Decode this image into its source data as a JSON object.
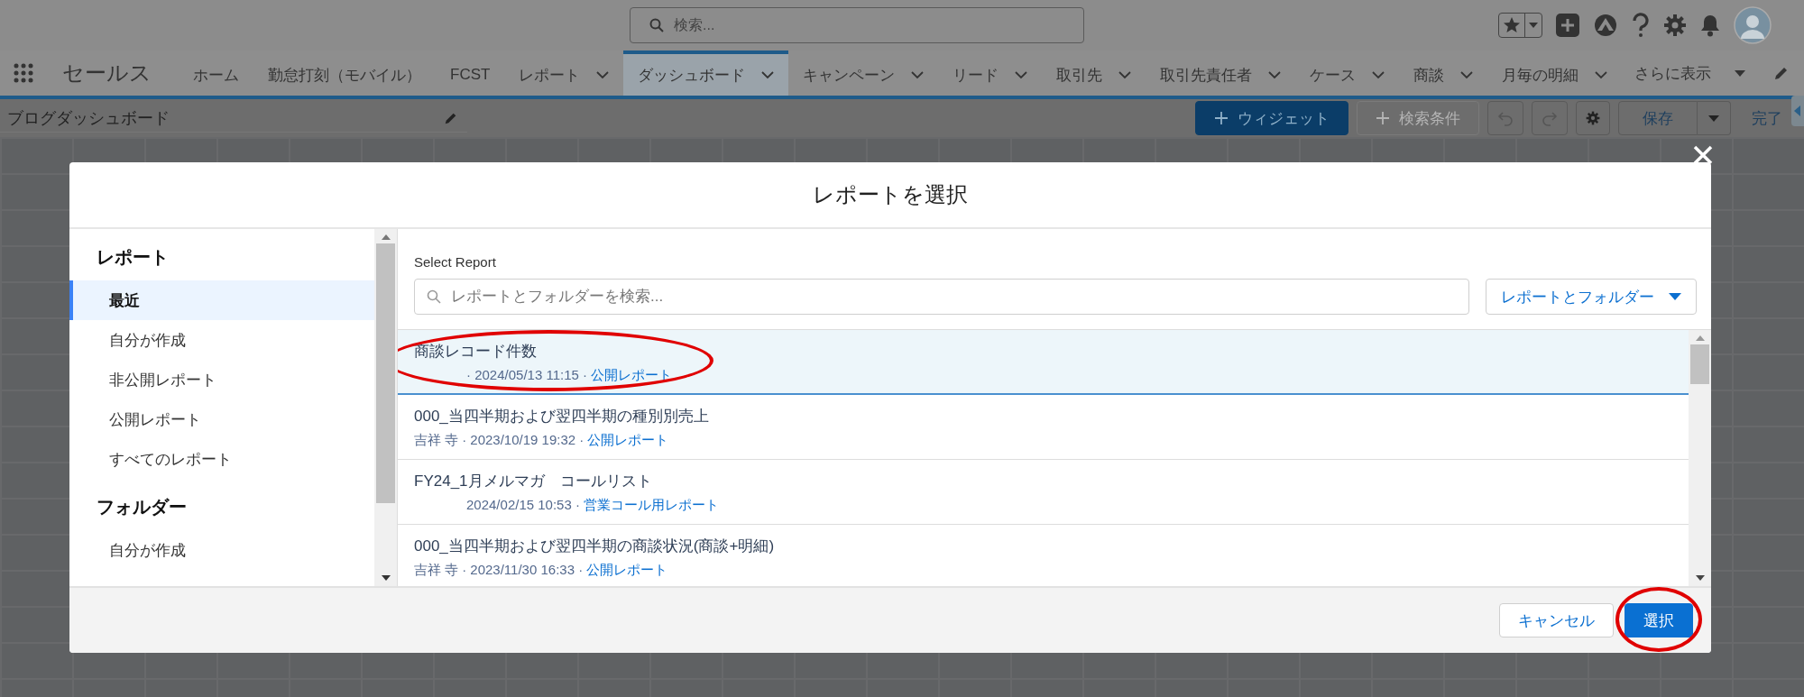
{
  "global_search": {
    "placeholder": "検索..."
  },
  "app_name": "セールス",
  "nav_tabs": [
    {
      "label": "ホーム",
      "selected": false,
      "has_menu": false
    },
    {
      "label": "勤怠打刻（モバイル）",
      "selected": false,
      "has_menu": false
    },
    {
      "label": "FCST",
      "selected": false,
      "has_menu": false
    },
    {
      "label": "レポート",
      "selected": false,
      "has_menu": true
    },
    {
      "label": "ダッシュボード",
      "selected": true,
      "has_menu": true
    },
    {
      "label": "キャンペーン",
      "selected": false,
      "has_menu": true
    },
    {
      "label": "リード",
      "selected": false,
      "has_menu": true
    },
    {
      "label": "取引先",
      "selected": false,
      "has_menu": true
    },
    {
      "label": "取引先責任者",
      "selected": false,
      "has_menu": true
    },
    {
      "label": "ケース",
      "selected": false,
      "has_menu": true
    },
    {
      "label": "商談",
      "selected": false,
      "has_menu": true
    },
    {
      "label": "月毎の明細",
      "selected": false,
      "has_menu": true
    }
  ],
  "nav_more": "さらに表示",
  "dashboard": {
    "title": "ブログダッシュボード",
    "widget_button": "ウィジェット",
    "filter_button": {
      "label": "検索条件",
      "disabled": true
    },
    "save_button": "保存",
    "done_link": "完了"
  },
  "modal": {
    "title": "レポートを選択",
    "sidebar": [
      {
        "heading": "レポート",
        "items": [
          {
            "label": "最近",
            "selected": true
          },
          {
            "label": "自分が作成",
            "selected": false
          },
          {
            "label": "非公開レポート",
            "selected": false
          },
          {
            "label": "公開レポート",
            "selected": false
          },
          {
            "label": "すべてのレポート",
            "selected": false
          }
        ]
      },
      {
        "heading": "フォルダー",
        "items": [
          {
            "label": "自分が作成",
            "selected": false
          }
        ]
      }
    ],
    "select_label": "Select Report",
    "search": {
      "placeholder": "レポートとフォルダーを検索..."
    },
    "filter_dropdown": "レポートとフォルダー",
    "reports": [
      {
        "name": "商談レコード件数",
        "meta": "· 2024/05/13 11:15 ·",
        "folder": "公開レポート",
        "selected": true,
        "circled": true
      },
      {
        "name": "000_当四半期および翌四半期の種別別売上",
        "owner": "吉祥 寺",
        "meta": "· 2023/10/19 19:32 ·",
        "folder": "公開レポート",
        "selected": false,
        "circled": false
      },
      {
        "name": "FY24_1月メルマガ　コールリスト",
        "meta": "2024/02/15 10:53 ·",
        "folder": "営業コール用レポート",
        "selected": false,
        "circled": false
      },
      {
        "name": "000_当四半期および翌四半期の商談状況(商談+明細)",
        "owner": "吉祥 寺",
        "meta": "· 2023/11/30 16:33 ·",
        "folder": "公開レポート",
        "selected": false,
        "circled": false
      }
    ],
    "buttons": [
      {
        "label": "キャンセル",
        "kind": "neutral",
        "circled": false
      },
      {
        "label": "選択",
        "kind": "brand",
        "circled": true
      }
    ]
  }
}
